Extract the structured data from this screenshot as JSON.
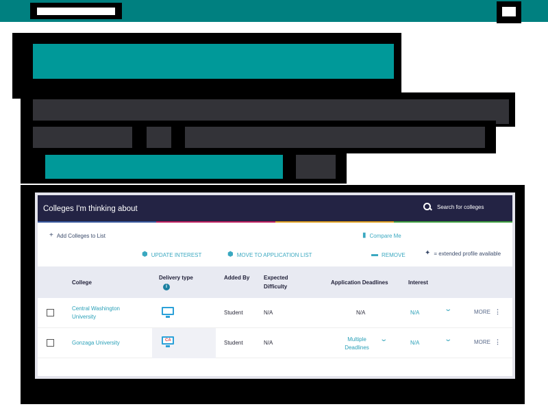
{
  "card": {
    "title": "Colleges I'm thinking about",
    "search_label": "Search for colleges"
  },
  "actions": {
    "add": "Add Colleges to List",
    "compare": "Compare Me",
    "update": "UPDATE INTEREST",
    "move": "MOVE TO APPLICATION LIST",
    "remove": "REMOVE",
    "legend": "= extended profile available"
  },
  "table": {
    "headers": {
      "college": "College",
      "delivery": "Delivery type",
      "added_by": "Added By",
      "difficulty": "Expected Difficulty",
      "deadlines": "Application Deadlines",
      "interest": "Interest"
    },
    "rows": [
      {
        "college": "Central Washington University",
        "delivery_icon": "monitor-icon",
        "added_by": "Student",
        "difficulty": "N/A",
        "deadlines": "N/A",
        "interest": "N/A",
        "more": "MORE"
      },
      {
        "college": "Gonzaga University",
        "delivery_icon": "monitor-ca-icon",
        "delivery_badge": "CA",
        "added_by": "Student",
        "difficulty": "N/A",
        "deadlines": "Multiple Deadlines",
        "interest": "N/A",
        "more": "MORE"
      }
    ]
  },
  "colors": {
    "header_bg": "#232344",
    "teal": "#009999",
    "link": "#2aa0b8",
    "stripe": [
      "#3a5aa0",
      "#c02060",
      "#e0a020",
      "#40a040"
    ]
  }
}
